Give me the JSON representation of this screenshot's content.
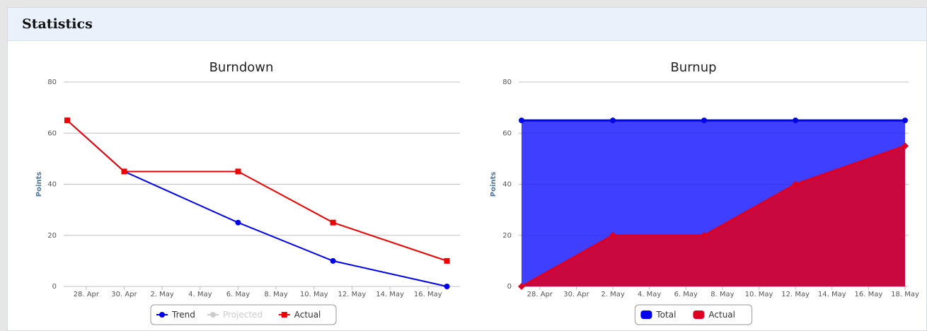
{
  "panel": {
    "title": "Statistics"
  },
  "chart_data": [
    {
      "type": "line",
      "title": "Burndown",
      "xlabel": "",
      "ylabel": "Points",
      "ylim": [
        0,
        80
      ],
      "yticks": [
        0,
        20,
        40,
        60,
        80
      ],
      "xlim": [
        0,
        20.5
      ],
      "xticks": [
        {
          "label": "28. Apr",
          "x": 1
        },
        {
          "label": "30. Apr",
          "x": 3
        },
        {
          "label": "2. May",
          "x": 5
        },
        {
          "label": "4. May",
          "x": 7
        },
        {
          "label": "6. May",
          "x": 9
        },
        {
          "label": "8. May",
          "x": 11
        },
        {
          "label": "10. May",
          "x": 13
        },
        {
          "label": "12. May",
          "x": 15
        },
        {
          "label": "14. May",
          "x": 17
        },
        {
          "label": "16. May",
          "x": 19
        }
      ],
      "grid": true,
      "legend": "bottom-center",
      "series": [
        {
          "name": "Trend",
          "color": "#0000ee",
          "marker": "circle",
          "points": [
            [
              0,
              65
            ],
            [
              3,
              45
            ],
            [
              9,
              25
            ],
            [
              14,
              10
            ],
            [
              20,
              0
            ]
          ],
          "visible": true
        },
        {
          "name": "Projected",
          "color": "#cccccc",
          "marker": "circle",
          "points": [],
          "visible": false
        },
        {
          "name": "Actual",
          "color": "#ee0000",
          "marker": "square",
          "points": [
            [
              0,
              65
            ],
            [
              3,
              45
            ],
            [
              9,
              45
            ],
            [
              14,
              25
            ],
            [
              20,
              10
            ]
          ],
          "visible": true
        }
      ]
    },
    {
      "type": "area",
      "title": "Burnup",
      "xlabel": "",
      "ylabel": "Points",
      "ylim": [
        0,
        80
      ],
      "yticks": [
        0,
        20,
        40,
        60,
        80
      ],
      "xlim": [
        0,
        21
      ],
      "xticks": [
        {
          "label": "28. Apr",
          "x": 1
        },
        {
          "label": "30. Apr",
          "x": 3
        },
        {
          "label": "2. May",
          "x": 5
        },
        {
          "label": "4. May",
          "x": 7
        },
        {
          "label": "6. May",
          "x": 9
        },
        {
          "label": "8. May",
          "x": 11
        },
        {
          "label": "10. May",
          "x": 13
        },
        {
          "label": "12. May",
          "x": 15
        },
        {
          "label": "14. May",
          "x": 17
        },
        {
          "label": "16. May",
          "x": 19
        },
        {
          "label": "18. May",
          "x": 21
        }
      ],
      "grid": true,
      "legend": "bottom-center",
      "series": [
        {
          "name": "Total",
          "color": "#0000ee",
          "fill": "#2323ff",
          "marker": "circle",
          "points": [
            [
              0,
              65
            ],
            [
              5,
              65
            ],
            [
              10,
              65
            ],
            [
              15,
              65
            ],
            [
              21,
              65
            ]
          ]
        },
        {
          "name": "Actual",
          "color": "#dd0022",
          "fill": "#dd0022",
          "marker": "diamond",
          "points": [
            [
              0,
              0
            ],
            [
              5,
              20
            ],
            [
              10,
              20
            ],
            [
              15,
              40
            ],
            [
              21,
              55
            ]
          ]
        }
      ]
    }
  ]
}
